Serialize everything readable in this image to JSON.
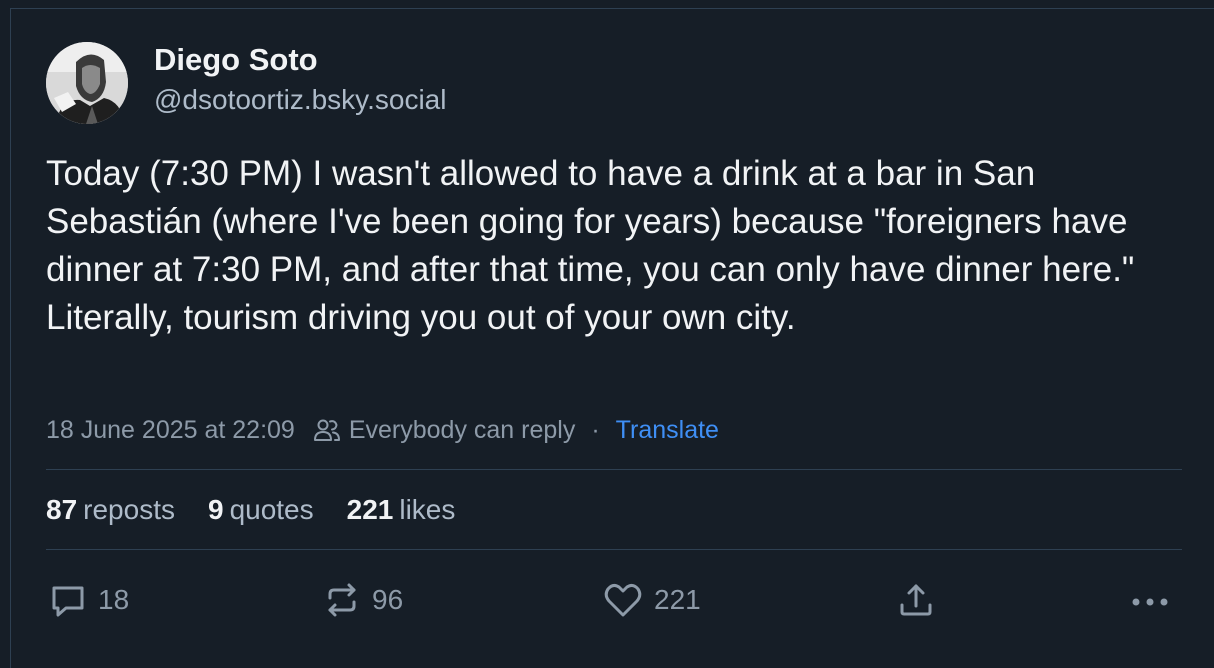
{
  "author": {
    "display_name": "Diego Soto",
    "handle": "@dsotoortiz.bsky.social"
  },
  "post": {
    "text": "Today (7:30 PM) I wasn't allowed to have a drink at a bar in San Sebastián (where I've been going for years) because \"foreigners have dinner at 7:30 PM, and after that time, you can only have dinner here.\"\nLiterally, tourism driving you out of your own city.",
    "timestamp": "18 June 2025 at 22:09",
    "reply_setting": "Everybody can reply",
    "separator": "·",
    "translate_label": "Translate"
  },
  "stats": {
    "reposts": {
      "count": "87",
      "label": "reposts"
    },
    "quotes": {
      "count": "9",
      "label": "quotes"
    },
    "likes": {
      "count": "221",
      "label": "likes"
    }
  },
  "actions": {
    "reply": {
      "icon": "comment-icon",
      "count": "18"
    },
    "repost": {
      "icon": "repost-icon",
      "count": "96"
    },
    "like": {
      "icon": "heart-icon",
      "count": "221"
    },
    "share": {
      "icon": "share-icon"
    },
    "more": {
      "icon": "more-icon"
    }
  },
  "colors": {
    "background": "#161e27",
    "text": "#f1f3f5",
    "muted": "#8d9aa8",
    "link": "#3f8ff5",
    "border": "#2e4052"
  }
}
